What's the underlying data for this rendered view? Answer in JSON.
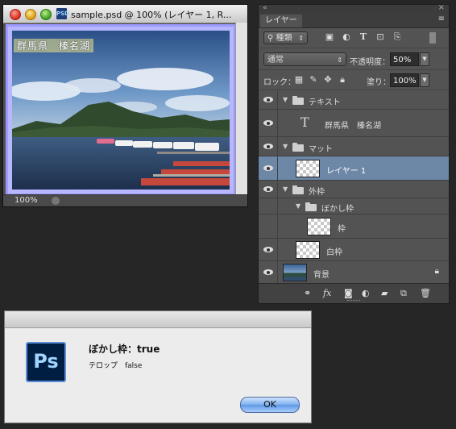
{
  "document": {
    "title": "sample.psd @ 100% (レイヤー 1, R...",
    "canvas_caption": "群馬県　榛名湖",
    "zoom": "100%"
  },
  "layers_panel": {
    "tab_label": "レイヤー",
    "filter_label": "種類",
    "blend_mode": "通常",
    "opacity_label": "不透明度：",
    "opacity_value": "50%",
    "lock_label": "ロック：",
    "fill_label": "塗り：",
    "fill_value": "100%",
    "layers": [
      {
        "name": "テキスト",
        "kind": "group"
      },
      {
        "name": "群馬県　榛名湖",
        "kind": "text"
      },
      {
        "name": "マット",
        "kind": "group"
      },
      {
        "name": "レイヤー 1",
        "kind": "pixel",
        "selected": true
      },
      {
        "name": "外枠",
        "kind": "group"
      },
      {
        "name": "ぼかし枠",
        "kind": "group"
      },
      {
        "name": "枠",
        "kind": "pixel"
      },
      {
        "name": "白枠",
        "kind": "pixel"
      },
      {
        "name": "背景",
        "kind": "background",
        "locked": true
      }
    ]
  },
  "alert": {
    "message": "ぼかし枠：true",
    "info": "テロップ　false",
    "ok_label": "OK",
    "app_icon_text": "Ps"
  },
  "colors": {
    "selected_row": "#6d87a6",
    "panel_bg": "#535353",
    "canvas_frame": "#b8b6ff"
  }
}
